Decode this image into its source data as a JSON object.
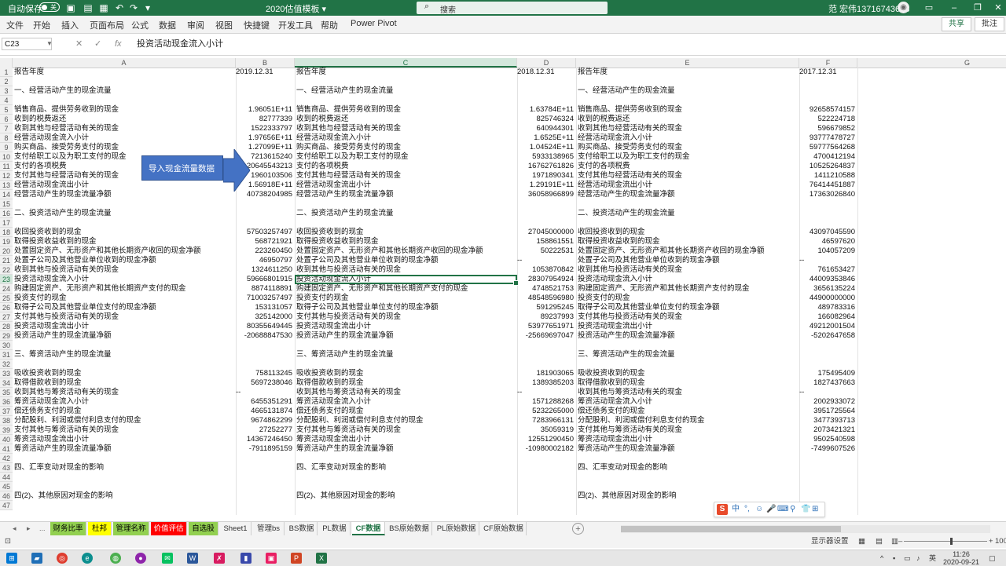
{
  "titlebar": {
    "autosave_label": "自动保存",
    "autosave_state": "关",
    "doc_title": "2020估值模板 ▾",
    "search_placeholder": "搜索",
    "user": "范 宏伟13716743613"
  },
  "ribbon": {
    "tabs": [
      "文件",
      "开始",
      "插入",
      "页面布局",
      "公式",
      "数据",
      "审阅",
      "视图",
      "快捷键",
      "开发工具",
      "帮助",
      "Power Pivot"
    ],
    "share": "共享",
    "comment": "批注"
  },
  "formula_bar": {
    "name_box": "C23",
    "formula": "投资活动现金流入小计"
  },
  "columns": [
    "A",
    "B",
    "C",
    "D",
    "E",
    "F",
    "G"
  ],
  "selected_cell": {
    "col": "C",
    "row": 23
  },
  "overlay": {
    "text_box": "导入现金流量数据"
  },
  "rows": [
    [
      "报告年度",
      "2019.12.31",
      "报告年度",
      "2018.12.31",
      "报告年度",
      "2017.12.31"
    ],
    [
      "",
      "",
      "",
      "",
      "",
      ""
    ],
    [
      "一、经营活动产生的现金流量",
      "",
      "一、经营活动产生的现金流量",
      "",
      "一、经营活动产生的现金流量",
      ""
    ],
    [
      "",
      "",
      "",
      "",
      "",
      ""
    ],
    [
      "销售商品、提供劳务收到的现金",
      "1.96051E+11",
      "销售商品、提供劳务收到的现金",
      "1.63784E+11",
      "销售商品、提供劳务收到的现金",
      "92658574157"
    ],
    [
      "收到的税费返还",
      "82777339",
      "收到的税费返还",
      "825746324",
      "收到的税费返还",
      "522224718"
    ],
    [
      "收到其他与经营活动有关的现金",
      "1522333797",
      "收到其他与经营活动有关的现金",
      "640944301",
      "收到其他与经营活动有关的现金",
      "596679852"
    ],
    [
      "经营活动现金流入小计",
      "1.97656E+11",
      "经营活动现金流入小计",
      "1.6525E+11",
      "经营活动现金流入小计",
      "93777478727"
    ],
    [
      "购买商品、接受劳务支付的现金",
      "1.27099E+11",
      "购买商品、接受劳务支付的现金",
      "1.04524E+11",
      "购买商品、接受劳务支付的现金",
      "59777564268"
    ],
    [
      "支付给职工以及为职工支付的现金",
      "7213615240",
      "支付给职工以及为职工支付的现金",
      "5933138965",
      "支付给职工以及为职工支付的现金",
      "4700412194"
    ],
    [
      "支付的各项税费",
      "20645543213",
      "支付的各项税费",
      "16762761826",
      "支付的各项税费",
      "10525264837"
    ],
    [
      "支付其他与经营活动有关的现金",
      "1960103506",
      "支付其他与经营活动有关的现金",
      "1971890341",
      "支付其他与经营活动有关的现金",
      "1411210588"
    ],
    [
      "经营活动现金流出小计",
      "1.56918E+11",
      "经营活动现金流出小计",
      "1.29191E+11",
      "经营活动现金流出小计",
      "76414451887"
    ],
    [
      "经营活动产生的现金流量净额",
      "40738204985",
      "经营活动产生的现金流量净额",
      "36058966899",
      "经营活动产生的现金流量净额",
      "17363026840"
    ],
    [
      "",
      "",
      "",
      "",
      "",
      ""
    ],
    [
      "二、投资活动产生的现金流量",
      "",
      "二、投资活动产生的现金流量",
      "",
      "二、投资活动产生的现金流量",
      ""
    ],
    [
      "",
      "",
      "",
      "",
      "",
      ""
    ],
    [
      "收回投资收到的现金",
      "57503257497",
      "收回投资收到的现金",
      "27045000000",
      "收回投资收到的现金",
      "43097045590"
    ],
    [
      "取得投资收益收到的现金",
      "568721921",
      "取得投资收益收到的现金",
      "158861551",
      "取得投资收益收到的现金",
      "46597620"
    ],
    [
      "处置固定资产、无形资产和其他长期资产收回的现金净额",
      "223260450",
      "处置固定资产、无形资产和其他长期资产收回的现金净额",
      "50222531",
      "处置固定资产、无形资产和其他长期资产收回的现金净额",
      "104057209"
    ],
    [
      "处置子公司及其他营业单位收到的现金净额",
      "46950797",
      "处置子公司及其他营业单位收到的现金净额",
      "--",
      "处置子公司及其他营业单位收到的现金净额",
      "--"
    ],
    [
      "收到其他与投资活动有关的现金",
      "1324611250",
      "收到其他与投资活动有关的现金",
      "1053870842",
      "收到其他与投资活动有关的现金",
      "761653427"
    ],
    [
      "投资活动现金流入小计",
      "59666801915",
      "投资活动现金流入小计",
      "28307954924",
      "投资活动现金流入小计",
      "44009353846"
    ],
    [
      "购建固定资产、无形资产和其他长期资产支付的现金",
      "8874118891",
      "购建固定资产、无形资产和其他长期资产支付的现金",
      "4748521753",
      "购建固定资产、无形资产和其他长期资产支付的现金",
      "3656135224"
    ],
    [
      "投资支付的现金",
      "71003257497",
      "投资支付的现金",
      "48548596980",
      "投资支付的现金",
      "44900000000"
    ],
    [
      "取得子公司及其他营业单位支付的现金净额",
      "153131057",
      "取得子公司及其他营业单位支付的现金净额",
      "591295245",
      "取得子公司及其他营业单位支付的现金净额",
      "489783316"
    ],
    [
      "支付其他与投资活动有关的现金",
      "325142000",
      "支付其他与投资活动有关的现金",
      "89237993",
      "支付其他与投资活动有关的现金",
      "166082964"
    ],
    [
      "投资活动现金流出小计",
      "80355649445",
      "投资活动现金流出小计",
      "53977651971",
      "投资活动现金流出小计",
      "49212001504"
    ],
    [
      "投资活动产生的现金流量净额",
      "-20688847530",
      "投资活动产生的现金流量净额",
      "-25669697047",
      "投资活动产生的现金流量净额",
      "-5202647658"
    ],
    [
      "",
      "",
      "",
      "",
      "",
      ""
    ],
    [
      "三、筹资活动产生的现金流量",
      "",
      "三、筹资活动产生的现金流量",
      "",
      "三、筹资活动产生的现金流量",
      ""
    ],
    [
      "",
      "",
      "",
      "",
      "",
      ""
    ],
    [
      "吸收投资收到的现金",
      "758113245",
      "吸收投资收到的现金",
      "181903065",
      "吸收投资收到的现金",
      "175495409"
    ],
    [
      "取得借款收到的现金",
      "5697238046",
      "取得借款收到的现金",
      "1389385203",
      "取得借款收到的现金",
      "1827437663"
    ],
    [
      "收到其他与筹资活动有关的现金",
      "--",
      "收到其他与筹资活动有关的现金",
      "--",
      "收到其他与筹资活动有关的现金",
      "--"
    ],
    [
      "筹资活动现金流入小计",
      "6455351291",
      "筹资活动现金流入小计",
      "1571288268",
      "筹资活动现金流入小计",
      "2002933072"
    ],
    [
      "偿还债务支付的现金",
      "4665131874",
      "偿还债务支付的现金",
      "5232265000",
      "偿还债务支付的现金",
      "3951725564"
    ],
    [
      "分配股利、利润或偿付利息支付的现金",
      "9674862299",
      "分配股利、利润或偿付利息支付的现金",
      "7283966131",
      "分配股利、利润或偿付利息支付的现金",
      "3477393713"
    ],
    [
      "支付其他与筹资活动有关的现金",
      "27252277",
      "支付其他与筹资活动有关的现金",
      "35059319",
      "支付其他与筹资活动有关的现金",
      "2073421321"
    ],
    [
      "筹资活动现金流出小计",
      "14367246450",
      "筹资活动现金流出小计",
      "12551290450",
      "筹资活动现金流出小计",
      "9502540598"
    ],
    [
      "筹资活动产生的现金流量净额",
      "-7911895159",
      "筹资活动产生的现金流量净额",
      "-10980002182",
      "筹资活动产生的现金流量净额",
      "-7499607526"
    ],
    [
      "",
      "",
      "",
      "",
      "",
      ""
    ],
    [
      "四、汇率变动对现金的影响",
      "",
      "四、汇率变动对现金的影响",
      "",
      "四、汇率变动对现金的影响",
      ""
    ],
    [
      "",
      "",
      "",
      "",
      "",
      ""
    ],
    [
      "",
      "",
      "",
      "",
      "",
      ""
    ],
    [
      "四(2)、其他原因对现金的影响",
      "",
      "四(2)、其他原因对现金的影响",
      "",
      "四(2)、其他原因对现金的影响",
      ""
    ],
    [
      "",
      "",
      "",
      "",
      "",
      ""
    ]
  ],
  "sheet_tabs": [
    {
      "label": "财务比率",
      "color": "#92d050",
      "text": "#000000"
    },
    {
      "label": "杜邦",
      "color": "#ffff00",
      "text": "#000000"
    },
    {
      "label": "管理名称",
      "color": "#92d050",
      "text": "#000000"
    },
    {
      "label": "价值评估",
      "color": "#ff0000",
      "text": "#ffffff"
    },
    {
      "label": "自选股",
      "color": "#92d050",
      "text": "#000000"
    },
    {
      "label": "Sheet1",
      "color": "",
      "text": ""
    },
    {
      "label": "管理bs",
      "color": "",
      "text": ""
    },
    {
      "label": "BS数据",
      "color": "",
      "text": ""
    },
    {
      "label": "PL数据",
      "color": "",
      "text": ""
    },
    {
      "label": "CF数据",
      "color": "",
      "text": "",
      "active": true
    },
    {
      "label": "BS原始数据",
      "color": "",
      "text": ""
    },
    {
      "label": "PL原始数据",
      "color": "",
      "text": ""
    },
    {
      "label": "CF原始数据",
      "color": "",
      "text": ""
    }
  ],
  "sheet_nav": {
    "prev": "◂",
    "next": "▸",
    "more": "...",
    "add": "+"
  },
  "statusbar": {
    "display_settings": "显示器设置",
    "zoom": "100%"
  },
  "taskbar": {
    "time": "11:26",
    "date": "2020-09-21"
  },
  "ime": {
    "logo": "S",
    "items": [
      "中",
      "°,",
      "☺",
      "🎤",
      "⌨",
      "⚲",
      "👕",
      "⊞"
    ]
  },
  "colors": {
    "excel_green": "#217346",
    "shape_blue": "#4472c4"
  }
}
